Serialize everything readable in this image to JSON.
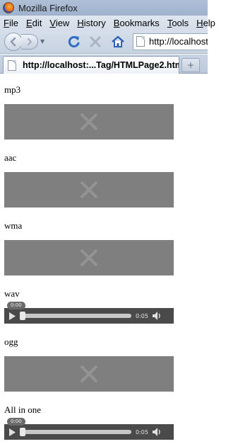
{
  "window": {
    "title": "Mozilla Firefox"
  },
  "menubar": {
    "items": [
      {
        "label": "File",
        "accel": "F",
        "rest": "ile"
      },
      {
        "label": "Edit",
        "accel": "E",
        "rest": "dit"
      },
      {
        "label": "View",
        "accel": "V",
        "rest": "iew"
      },
      {
        "label": "History",
        "accel": "H",
        "rest": "istory"
      },
      {
        "label": "Bookmarks",
        "accel": "B",
        "rest": "ookmarks"
      },
      {
        "label": "Tools",
        "accel": "T",
        "rest": "ools"
      },
      {
        "label": "Help",
        "accel": "H",
        "rest": "elp"
      }
    ]
  },
  "navbar": {
    "url": "http://localhost"
  },
  "tabs": {
    "active_title": "http://localhost:...Tag/HTMLPage2.htm",
    "newtab_symbol": "+"
  },
  "content": {
    "sections": [
      {
        "label": "mp3",
        "kind": "missing"
      },
      {
        "label": "aac",
        "kind": "missing"
      },
      {
        "label": "wma",
        "kind": "missing"
      },
      {
        "label": "wav",
        "kind": "player",
        "current": "0:00",
        "duration": "0:05",
        "progress": 0
      },
      {
        "label": "ogg",
        "kind": "missing"
      },
      {
        "label": "All in one",
        "kind": "player",
        "current": "0:00",
        "duration": "0:05",
        "progress": 0
      }
    ]
  },
  "colors": {
    "missing_media_bg": "#7f7f7f",
    "player_bg": "#4a4a4a"
  }
}
